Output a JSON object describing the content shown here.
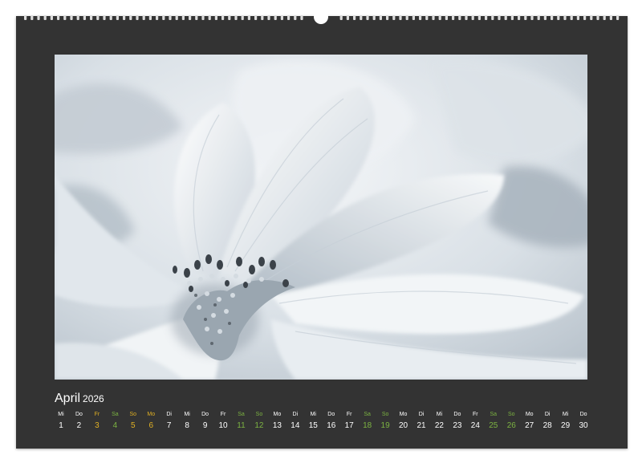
{
  "calendar": {
    "month": "April",
    "year": "2026",
    "colors": {
      "page": "#333333",
      "text": "#ffffff",
      "weekend": "#7cb342",
      "holiday": "#e0b024"
    },
    "days": [
      {
        "abbr": "Mi",
        "num": "1",
        "kind": "weekday"
      },
      {
        "abbr": "Do",
        "num": "2",
        "kind": "weekday"
      },
      {
        "abbr": "Fr",
        "num": "3",
        "kind": "holiday"
      },
      {
        "abbr": "Sa",
        "num": "4",
        "kind": "sat"
      },
      {
        "abbr": "So",
        "num": "5",
        "kind": "holiday"
      },
      {
        "abbr": "Mo",
        "num": "6",
        "kind": "holiday"
      },
      {
        "abbr": "Di",
        "num": "7",
        "kind": "weekday"
      },
      {
        "abbr": "Mi",
        "num": "8",
        "kind": "weekday"
      },
      {
        "abbr": "Do",
        "num": "9",
        "kind": "weekday"
      },
      {
        "abbr": "Fr",
        "num": "10",
        "kind": "weekday"
      },
      {
        "abbr": "Sa",
        "num": "11",
        "kind": "sat"
      },
      {
        "abbr": "So",
        "num": "12",
        "kind": "sun"
      },
      {
        "abbr": "Mo",
        "num": "13",
        "kind": "weekday"
      },
      {
        "abbr": "Di",
        "num": "14",
        "kind": "weekday"
      },
      {
        "abbr": "Mi",
        "num": "15",
        "kind": "weekday"
      },
      {
        "abbr": "Do",
        "num": "16",
        "kind": "weekday"
      },
      {
        "abbr": "Fr",
        "num": "17",
        "kind": "weekday"
      },
      {
        "abbr": "Sa",
        "num": "18",
        "kind": "sat"
      },
      {
        "abbr": "So",
        "num": "19",
        "kind": "sun"
      },
      {
        "abbr": "Mo",
        "num": "20",
        "kind": "weekday"
      },
      {
        "abbr": "Di",
        "num": "21",
        "kind": "weekday"
      },
      {
        "abbr": "Mi",
        "num": "22",
        "kind": "weekday"
      },
      {
        "abbr": "Do",
        "num": "23",
        "kind": "weekday"
      },
      {
        "abbr": "Fr",
        "num": "24",
        "kind": "weekday"
      },
      {
        "abbr": "Sa",
        "num": "25",
        "kind": "sat"
      },
      {
        "abbr": "So",
        "num": "26",
        "kind": "sun"
      },
      {
        "abbr": "Mo",
        "num": "27",
        "kind": "weekday"
      },
      {
        "abbr": "Di",
        "num": "28",
        "kind": "weekday"
      },
      {
        "abbr": "Mi",
        "num": "29",
        "kind": "weekday"
      },
      {
        "abbr": "Do",
        "num": "30",
        "kind": "weekday"
      }
    ]
  }
}
